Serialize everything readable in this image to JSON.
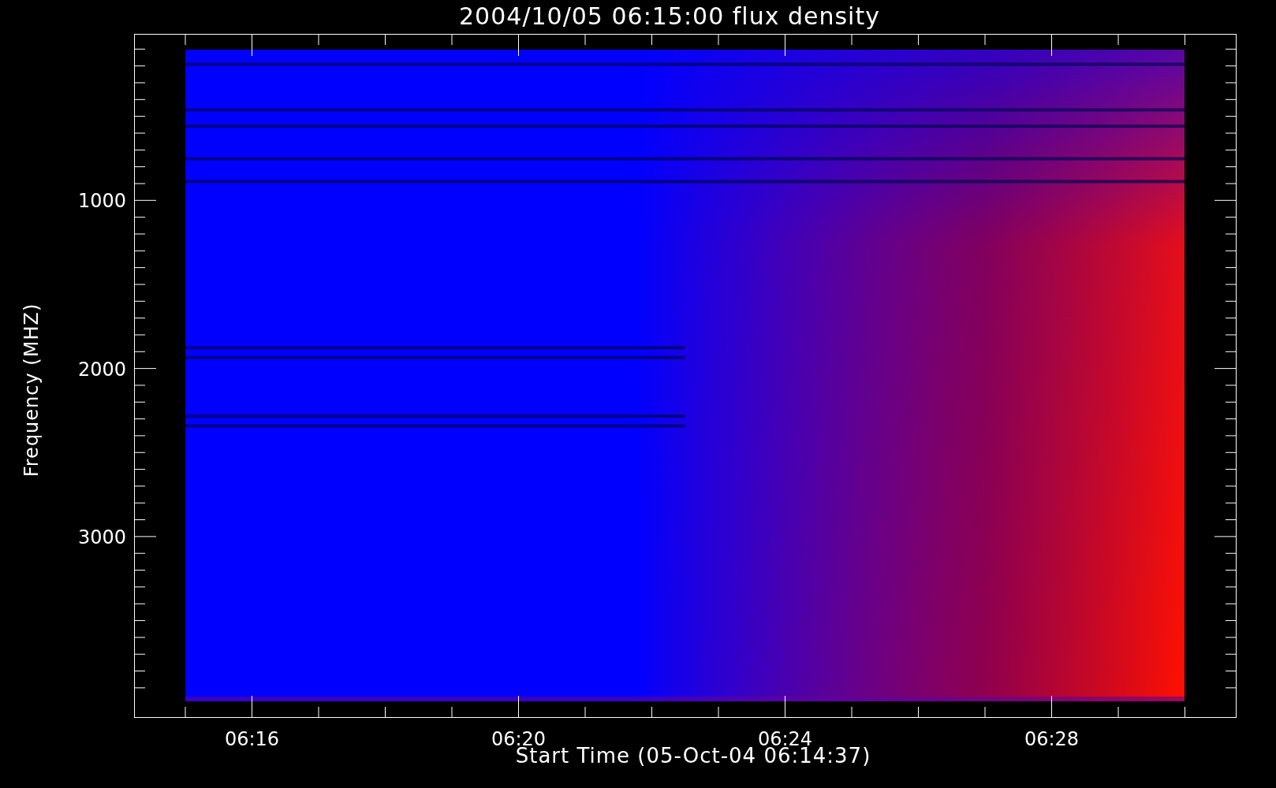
{
  "title": "2004/10/05 06:15:00 flux density",
  "y_axis": {
    "label": "Frequency (MHZ)",
    "ticks": [
      "1000",
      "2000",
      "3000"
    ]
  },
  "x_axis": {
    "label": "Start Time (05-Oct-04 06:14:37)",
    "ticks": [
      "06:16",
      "06:20",
      "06:24",
      "06:28"
    ]
  }
}
